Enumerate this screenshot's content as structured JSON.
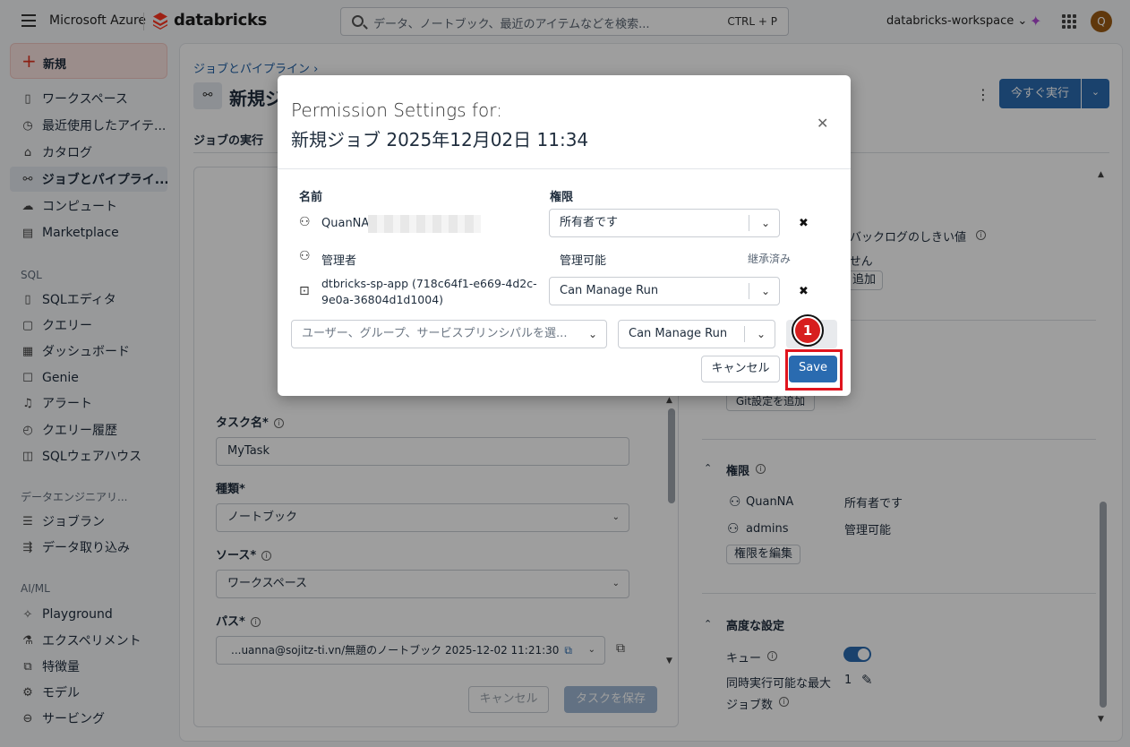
{
  "topbar": {
    "ms_label": "Microsoft Azure",
    "brand": "databricks",
    "search_placeholder": "データ、ノートブック、最近のアイテムなどを検索...",
    "search_shortcut": "CTRL + P",
    "workspace": "databricks-workspace",
    "avatar": "Q"
  },
  "sidebar": {
    "new_label": "新規",
    "items": [
      {
        "icon": "workspace-icon",
        "glyph": "▯",
        "label": "ワークスペース"
      },
      {
        "icon": "clock-icon",
        "glyph": "◷",
        "label": "最近使用したアイテ..."
      },
      {
        "icon": "catalog-icon",
        "glyph": "⌂",
        "label": "カタログ"
      },
      {
        "icon": "workflow-icon",
        "glyph": "⚯",
        "label": "ジョブとパイプライ..."
      },
      {
        "icon": "cloud-icon",
        "glyph": "☁",
        "label": "コンピュート"
      },
      {
        "icon": "store-icon",
        "glyph": "▤",
        "label": "Marketplace"
      }
    ],
    "sql_section": "SQL",
    "sql_items": [
      {
        "icon": "sql-editor-icon",
        "glyph": "▯",
        "label": "SQLエディタ"
      },
      {
        "icon": "query-icon",
        "glyph": "▢",
        "label": "クエリー"
      },
      {
        "icon": "dashboard-icon",
        "glyph": "▦",
        "label": "ダッシュボード"
      },
      {
        "icon": "genie-icon",
        "glyph": "☐",
        "label": "Genie"
      },
      {
        "icon": "bell-icon",
        "glyph": "♫",
        "label": "アラート"
      },
      {
        "icon": "history-icon",
        "glyph": "◴",
        "label": "クエリー履歴"
      },
      {
        "icon": "warehouse-icon",
        "glyph": "◫",
        "label": "SQLウェアハウス"
      }
    ],
    "de_section": "データエンジニアリ...",
    "de_items": [
      {
        "icon": "jobrun-icon",
        "glyph": "☰",
        "label": "ジョブラン"
      },
      {
        "icon": "ingest-icon",
        "glyph": "⇶",
        "label": "データ取り込み"
      }
    ],
    "ai_section": "AI/ML",
    "ai_items": [
      {
        "icon": "playground-icon",
        "glyph": "✧",
        "label": "Playground"
      },
      {
        "icon": "flask-icon",
        "glyph": "⚗",
        "label": "エクスペリメント"
      },
      {
        "icon": "feature-icon",
        "glyph": "⧉",
        "label": "特徴量"
      },
      {
        "icon": "model-icon",
        "glyph": "⚙",
        "label": "モデル"
      },
      {
        "icon": "serving-icon",
        "glyph": "⊖",
        "label": "サービング"
      }
    ]
  },
  "page": {
    "breadcrumb": "ジョブとパイプライン ›",
    "title": "新規ジ",
    "run_now": "今すぐ実行",
    "tab_runs": "ジョブの実行"
  },
  "task": {
    "name_label": "タスク名*",
    "name_value": "MyTask",
    "type_label": "種類*",
    "type_value": "ノートブック",
    "source_label": "ソース*",
    "source_value": "ワークスペース",
    "path_label": "パス*",
    "path_value": "...uanna@sojitz-ti.vn/無題のノートブック 2025-12-02 11:21:30",
    "cancel": "キャンセル",
    "save_task": "タスクを保存"
  },
  "right": {
    "backlog": "のバックログのしきい値",
    "none": "ません",
    "add": "追加",
    "git_add": "Git設定を追加",
    "perm_header": "権限",
    "perm_rows": [
      {
        "name": "QuanNA",
        "role": "所有者です"
      },
      {
        "name": "admins",
        "role": "管理可能"
      }
    ],
    "edit_perm": "権限を編集",
    "advanced": "高度な設定",
    "queue": "キュー",
    "max_concurrent_1": "同時実行可能な最大",
    "max_concurrent_2": "ジョブ数",
    "max_concurrent_value": "1"
  },
  "modal": {
    "title1": "Permission Settings for:",
    "title2": "新規ジョブ 2025年12月02日 11:34",
    "col_name": "名前",
    "col_perm": "権限",
    "rows": [
      {
        "name": "QuanNA",
        "perm": "所有者です"
      },
      {
        "name": "管理者",
        "perm": "管理可能",
        "note": "継承済み"
      },
      {
        "name_line1": "dtbricks-sp-app (718c64f1-e669-4d2c-",
        "name_line2": "9e0a-36804d1d1004)",
        "perm": "Can Manage Run"
      }
    ],
    "add_placeholder": "ユーザー、グループ、サービスプリンシパルを選...",
    "add_perm": "Can Manage Run",
    "cancel": "キャンセル",
    "save": "Save",
    "step_badge": "1"
  }
}
